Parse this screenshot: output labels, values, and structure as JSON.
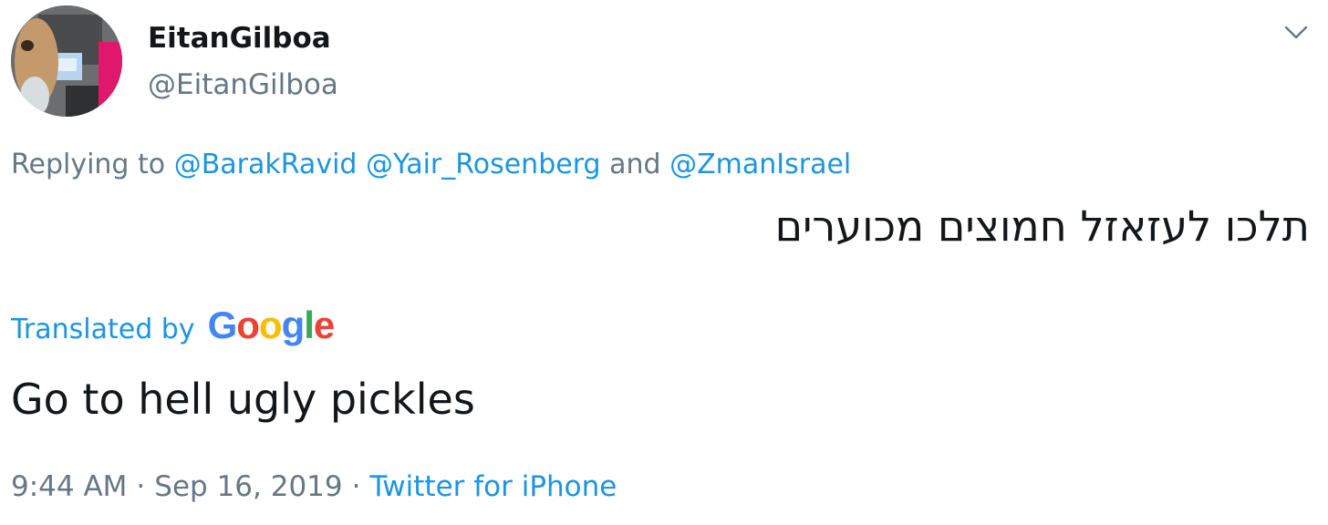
{
  "user": {
    "display_name": "EitanGilboa",
    "handle": "@EitanGilboa"
  },
  "reply": {
    "prefix": "Replying to",
    "mentions": [
      "@BarakRavid",
      "@Yair_Rosenberg",
      "@ZmanIsrael"
    ],
    "conjunction": "and"
  },
  "tweet": {
    "original_text": "תלכו לעזאזל חמוצים מכוערים",
    "translated_by": "Translated by",
    "translator_logo": "Google",
    "translation_text": "Go to hell ugly pickles"
  },
  "meta": {
    "time": "9:44 AM",
    "date": "Sep 16, 2019",
    "separator": "·",
    "source": "Twitter for iPhone"
  },
  "colors": {
    "link": "#1b95e0",
    "muted": "#657786",
    "text": "#14171a"
  },
  "icons": {
    "menu": "chevron-down-icon"
  }
}
